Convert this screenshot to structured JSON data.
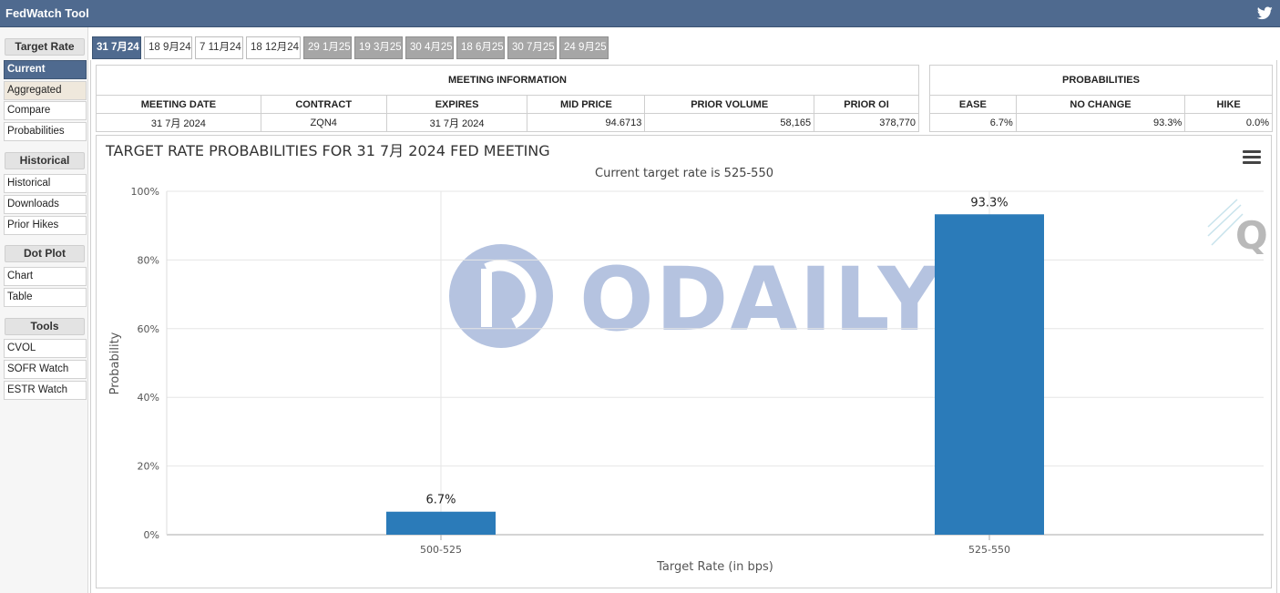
{
  "app": {
    "title": "FedWatch Tool",
    "share_icon": "twitter-icon"
  },
  "sidebar": {
    "sections": [
      {
        "header": "Target Rate",
        "items": [
          {
            "label": "Current",
            "state": "active"
          },
          {
            "label": "Aggregated",
            "state": "hover"
          },
          {
            "label": "Compare"
          },
          {
            "label": "Probabilities"
          }
        ]
      },
      {
        "header": "Historical",
        "items": [
          {
            "label": "Historical"
          },
          {
            "label": "Downloads"
          },
          {
            "label": "Prior Hikes"
          }
        ]
      },
      {
        "header": "Dot Plot",
        "items": [
          {
            "label": "Chart"
          },
          {
            "label": "Table"
          }
        ]
      },
      {
        "header": "Tools",
        "items": [
          {
            "label": "CVOL"
          },
          {
            "label": "SOFR Watch"
          },
          {
            "label": "ESTR Watch"
          }
        ]
      }
    ]
  },
  "tabs": [
    {
      "label": "31 7月24",
      "state": "active"
    },
    {
      "label": "18 9月24",
      "state": "normal"
    },
    {
      "label": "7 11月24",
      "state": "normal"
    },
    {
      "label": "18 12月24",
      "state": "normal"
    },
    {
      "label": "29 1月25",
      "state": "future"
    },
    {
      "label": "19 3月25",
      "state": "future"
    },
    {
      "label": "30 4月25",
      "state": "future"
    },
    {
      "label": "18 6月25",
      "state": "future"
    },
    {
      "label": "30 7月25",
      "state": "future"
    },
    {
      "label": "24 9月25",
      "state": "future"
    }
  ],
  "meeting_info": {
    "title": "MEETING INFORMATION",
    "headers": [
      "MEETING DATE",
      "CONTRACT",
      "EXPIRES",
      "MID PRICE",
      "PRIOR VOLUME",
      "PRIOR OI"
    ],
    "row": [
      "31 7月 2024",
      "ZQN4",
      "31 7月 2024",
      "94.6713",
      "58,165",
      "378,770"
    ]
  },
  "probabilities": {
    "title": "PROBABILITIES",
    "headers": [
      "EASE",
      "NO CHANGE",
      "HIKE"
    ],
    "row": [
      "6.7%",
      "93.3%",
      "0.0%"
    ]
  },
  "chart": {
    "menu_icon": "hamburger-menu-icon",
    "bar_color": "#2b7bb9",
    "watermark_text": "ODAILY",
    "watermark_color": "#9db0d6"
  },
  "chart_data": {
    "type": "bar",
    "title": "TARGET RATE PROBABILITIES FOR 31 7月 2024 FED MEETING",
    "subtitle": "Current target rate is 525-550",
    "categories": [
      "500-525",
      "525-550"
    ],
    "values": [
      6.7,
      93.3
    ],
    "data_labels": [
      "6.7%",
      "93.3%"
    ],
    "xlabel": "Target Rate (in bps)",
    "ylabel": "Probability",
    "ylim": [
      0,
      100
    ],
    "yticks": [
      "0%",
      "20%",
      "40%",
      "60%",
      "80%",
      "100%"
    ],
    "grid": true,
    "legend": "none"
  }
}
